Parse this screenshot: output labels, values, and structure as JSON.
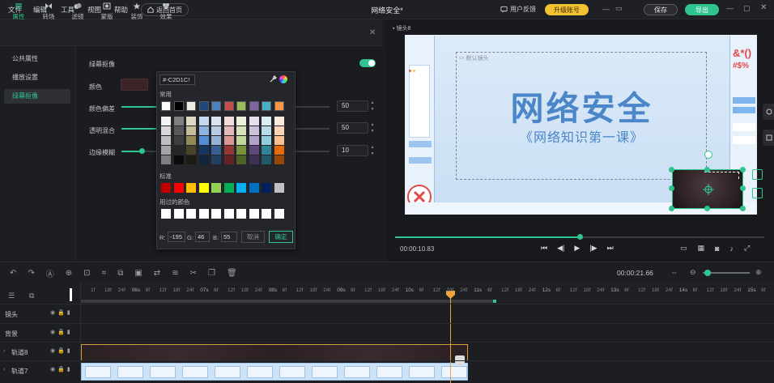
{
  "app": {
    "title": "网络安全*",
    "colors": {
      "accent": "#30c590",
      "upgrade": "#f1c232",
      "bg": "#1b1c20"
    }
  },
  "menu": [
    "文件",
    "编辑",
    "工具",
    "视图",
    "帮助"
  ],
  "top": {
    "home": "返回首页",
    "feedback": "用户反馈",
    "upgrade": "升级账号",
    "save": "保存",
    "export": "导出"
  },
  "tabs": [
    {
      "label": "属性",
      "icon": "sliders-icon"
    },
    {
      "label": "转场",
      "icon": "transition-icon"
    },
    {
      "label": "滤镜",
      "icon": "filter-icon"
    },
    {
      "label": "蒙版",
      "icon": "mask-icon"
    },
    {
      "label": "装饰",
      "icon": "sticker-icon"
    },
    {
      "label": "效果",
      "icon": "effect-icon"
    }
  ],
  "sidebar": [
    "公共属性",
    "播放设置",
    "绿幕抠像"
  ],
  "props": {
    "chroma": "绿幕抠像",
    "color": "颜色",
    "deviation": "颜色偏差",
    "deviation_val": "50",
    "blend": "透明混合",
    "blend_val": "50",
    "edge": "边缘模糊",
    "edge_val": "10"
  },
  "picker": {
    "hex": "#-C2D1C!",
    "common": "常用",
    "standard": "标准",
    "used": "用过的颜色",
    "r_label": "R:",
    "r": "-195",
    "g_label": "G:",
    "g": "46",
    "b_label": "B:",
    "b": "55",
    "cancel": "取消",
    "ok": "确定"
  },
  "preview": {
    "tag": "镜头8",
    "default_shot": "默认镜头",
    "title": "网络安全",
    "subtitle": "《网络知识第一课》",
    "side_text1": "&*()",
    "side_text2": "#$%",
    "time_current": "00:00:10.83"
  },
  "toolbar": {
    "time_total": "00:00:21.66"
  },
  "ruler": [
    "1f",
    "18f",
    "24f",
    "06s",
    "6f",
    "12f",
    "18f",
    "24f",
    "07s",
    "6f",
    "12f",
    "18f",
    "24f",
    "08s",
    "6f",
    "12f",
    "18f",
    "24f",
    "09s",
    "6f",
    "12f",
    "18f",
    "24f",
    "10s",
    "6f",
    "12f",
    "18f",
    "24f",
    "11s",
    "6f",
    "12f",
    "18f",
    "24f",
    "12s",
    "6f",
    "12f",
    "18f",
    "24f",
    "13s",
    "6f",
    "12f",
    "18f",
    "24f",
    "14s",
    "6f",
    "12f",
    "18f",
    "24f",
    "15s",
    "6f"
  ],
  "tracks": [
    "镜头",
    "背景",
    "轨道8",
    "轨道7"
  ]
}
